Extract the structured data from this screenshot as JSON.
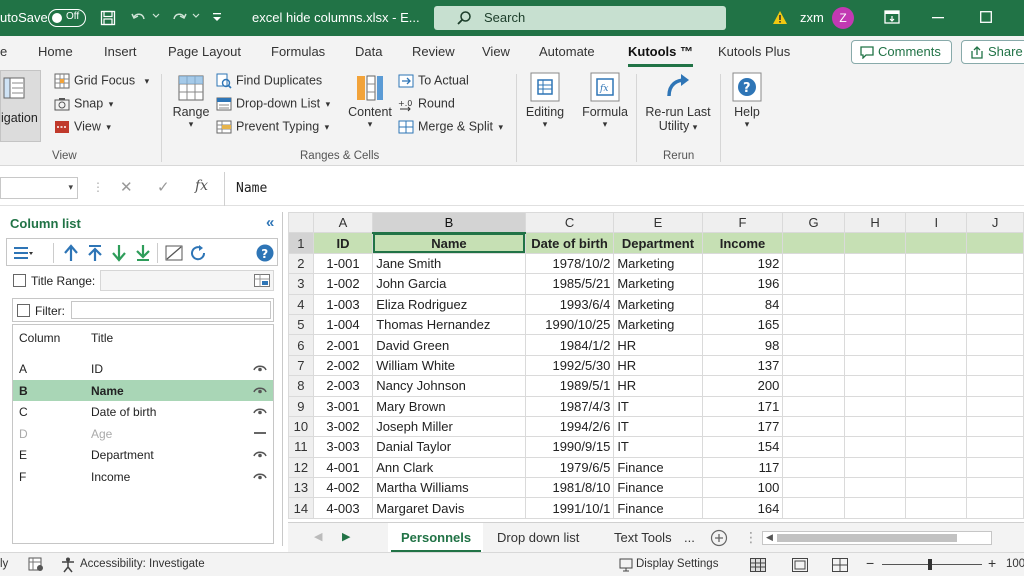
{
  "titlebar": {
    "autosave_label": "utoSave",
    "autosave_state": "Off",
    "doc_title": "excel hide columns.xlsx  -  E...",
    "search_placeholder": "Search",
    "user_name": "zxm",
    "avatar_letter": "Z"
  },
  "menu": {
    "tabs": [
      "e",
      "Home",
      "Insert",
      "Page Layout",
      "Formulas",
      "Data",
      "Review",
      "View",
      "Automate",
      "Kutools ™",
      "Kutools Plus"
    ],
    "active_tab": "Kutools ™",
    "comments_label": "Comments",
    "share_label": "Share"
  },
  "ribbon": {
    "navigation_label": "igation",
    "grid_focus": "Grid Focus",
    "snap": "Snap",
    "view": "View",
    "group_view": "View",
    "range": "Range",
    "find_duplicates": "Find Duplicates",
    "dropdown_list": "Drop-down List",
    "prevent_typing": "Prevent Typing",
    "content": "Content",
    "to_actual": "To Actual",
    "round": "Round",
    "merge_split": "Merge & Split",
    "group_ranges": "Ranges & Cells",
    "editing": "Editing",
    "formula": "Formula",
    "rerun_line1": "Re-run Last",
    "rerun_line2": "Utility",
    "group_rerun": "Rerun",
    "help": "Help"
  },
  "formula_bar": {
    "fx": "fx",
    "value": "Name"
  },
  "pane": {
    "title": "Column list",
    "title_range_label": "Title Range:",
    "filter_label": "Filter:",
    "col_header": "Column",
    "title_header": "Title",
    "rows": [
      {
        "col": "A",
        "title": "ID",
        "visible": true
      },
      {
        "col": "B",
        "title": "Name",
        "visible": true
      },
      {
        "col": "C",
        "title": "Date of birth",
        "visible": true
      },
      {
        "col": "D",
        "title": "Age",
        "visible": false
      },
      {
        "col": "E",
        "title": "Department",
        "visible": true
      },
      {
        "col": "F",
        "title": "Income",
        "visible": true
      }
    ],
    "selected_index": 1
  },
  "grid": {
    "columns": [
      "A",
      "B",
      "C",
      "E",
      "F",
      "G",
      "H",
      "I",
      "J"
    ],
    "headers": [
      "ID",
      "Name",
      "Date of birth",
      "Department",
      "Income"
    ],
    "rows": [
      [
        "1-001",
        "Jane Smith",
        "1978/10/2",
        "Marketing",
        "192"
      ],
      [
        "1-002",
        "John Garcia",
        "1985/5/21",
        "Marketing",
        "196"
      ],
      [
        "1-003",
        "Eliza Rodriguez",
        "1993/6/4",
        "Marketing",
        "84"
      ],
      [
        "1-004",
        "Thomas Hernandez",
        "1990/10/25",
        "Marketing",
        "165"
      ],
      [
        "2-001",
        "David Green",
        "1984/1/2",
        "HR",
        "98"
      ],
      [
        "2-002",
        "William White",
        "1992/5/30",
        "HR",
        "137"
      ],
      [
        "2-003",
        "Nancy Johnson",
        "1989/5/1",
        "HR",
        "200"
      ],
      [
        "3-001",
        "Mary Brown",
        "1987/4/3",
        "IT",
        "171"
      ],
      [
        "3-002",
        "Joseph Miller",
        "1994/2/6",
        "IT",
        "177"
      ],
      [
        "3-003",
        "Danial Taylor",
        "1990/9/15",
        "IT",
        "154"
      ],
      [
        "4-001",
        "Ann Clark",
        "1979/6/5",
        "Finance",
        "117"
      ],
      [
        "4-002",
        "Martha Williams",
        "1981/8/10",
        "Finance",
        "100"
      ],
      [
        "4-003",
        "Margaret Davis",
        "1991/10/1",
        "Finance",
        "164"
      ]
    ]
  },
  "sheets": {
    "tabs": [
      "Personnels",
      "Drop down list",
      "Text Tools"
    ],
    "active": "Personnels",
    "more": "..."
  },
  "status": {
    "ready": "ly",
    "accessibility": "Accessibility: Investigate",
    "display_settings": "Display Settings",
    "zoom": "100"
  },
  "colors": {
    "accent": "#217346",
    "header_fill": "#c6e0b4",
    "selected_row": "#a9d6b6"
  }
}
